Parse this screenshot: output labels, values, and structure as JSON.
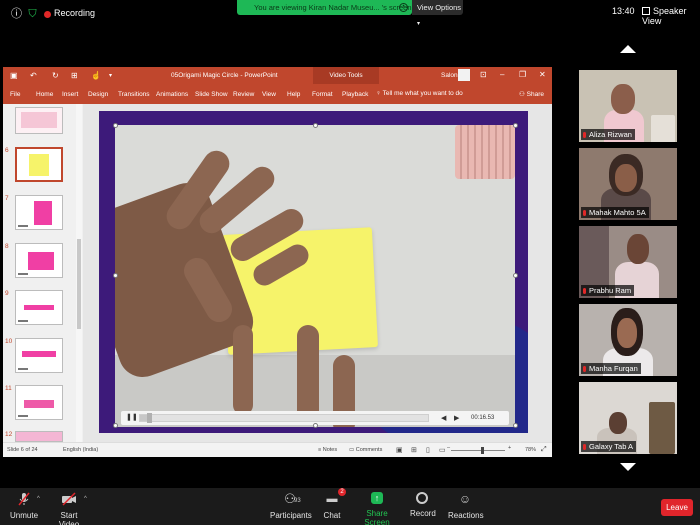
{
  "topbar": {
    "recording_label": "Recording",
    "share_banner": "You are viewing Kiran Nadar Museu... 's screen",
    "view_options": "View Options",
    "time": "13:40",
    "speaker_view": "Speaker View"
  },
  "ppt": {
    "doc_title": "05Origami Magic Circle  -  PowerPoint",
    "video_tools": "Video Tools",
    "user": "Saloni",
    "tabs": [
      "File",
      "Home",
      "Insert",
      "Design",
      "Transitions",
      "Animations",
      "Slide Show",
      "Review",
      "View",
      "Help",
      "Format",
      "Playback"
    ],
    "tell_me": "Tell me what you want to do",
    "share": "Share",
    "thumb_numbers": [
      "6",
      "7",
      "8",
      "9",
      "10",
      "11",
      "12"
    ],
    "video_time": "00:16.53",
    "video_progress": 0.03,
    "status": {
      "slide": "Slide 6 of 24",
      "language": "English (India)",
      "notes": "Notes",
      "comments": "Comments",
      "zoom": "78%"
    }
  },
  "participants": [
    {
      "name": "Aliza Rizwan"
    },
    {
      "name": "Mahak Mahto 5A"
    },
    {
      "name": "Prabhu Ram"
    },
    {
      "name": "Manha Furqan"
    },
    {
      "name": "Galaxy Tab A"
    }
  ],
  "toolbar": {
    "unmute": "Unmute",
    "start_video": "Start Video",
    "participants": "Participants",
    "participant_count": "93",
    "chat": "Chat",
    "chat_badge": "2",
    "share_screen": "Share Screen",
    "record": "Record",
    "reactions": "Reactions",
    "leave": "Leave"
  },
  "colors": {
    "ppt_accent": "#c0472d",
    "share_green": "#1eb856",
    "leave_red": "#e0252b"
  }
}
